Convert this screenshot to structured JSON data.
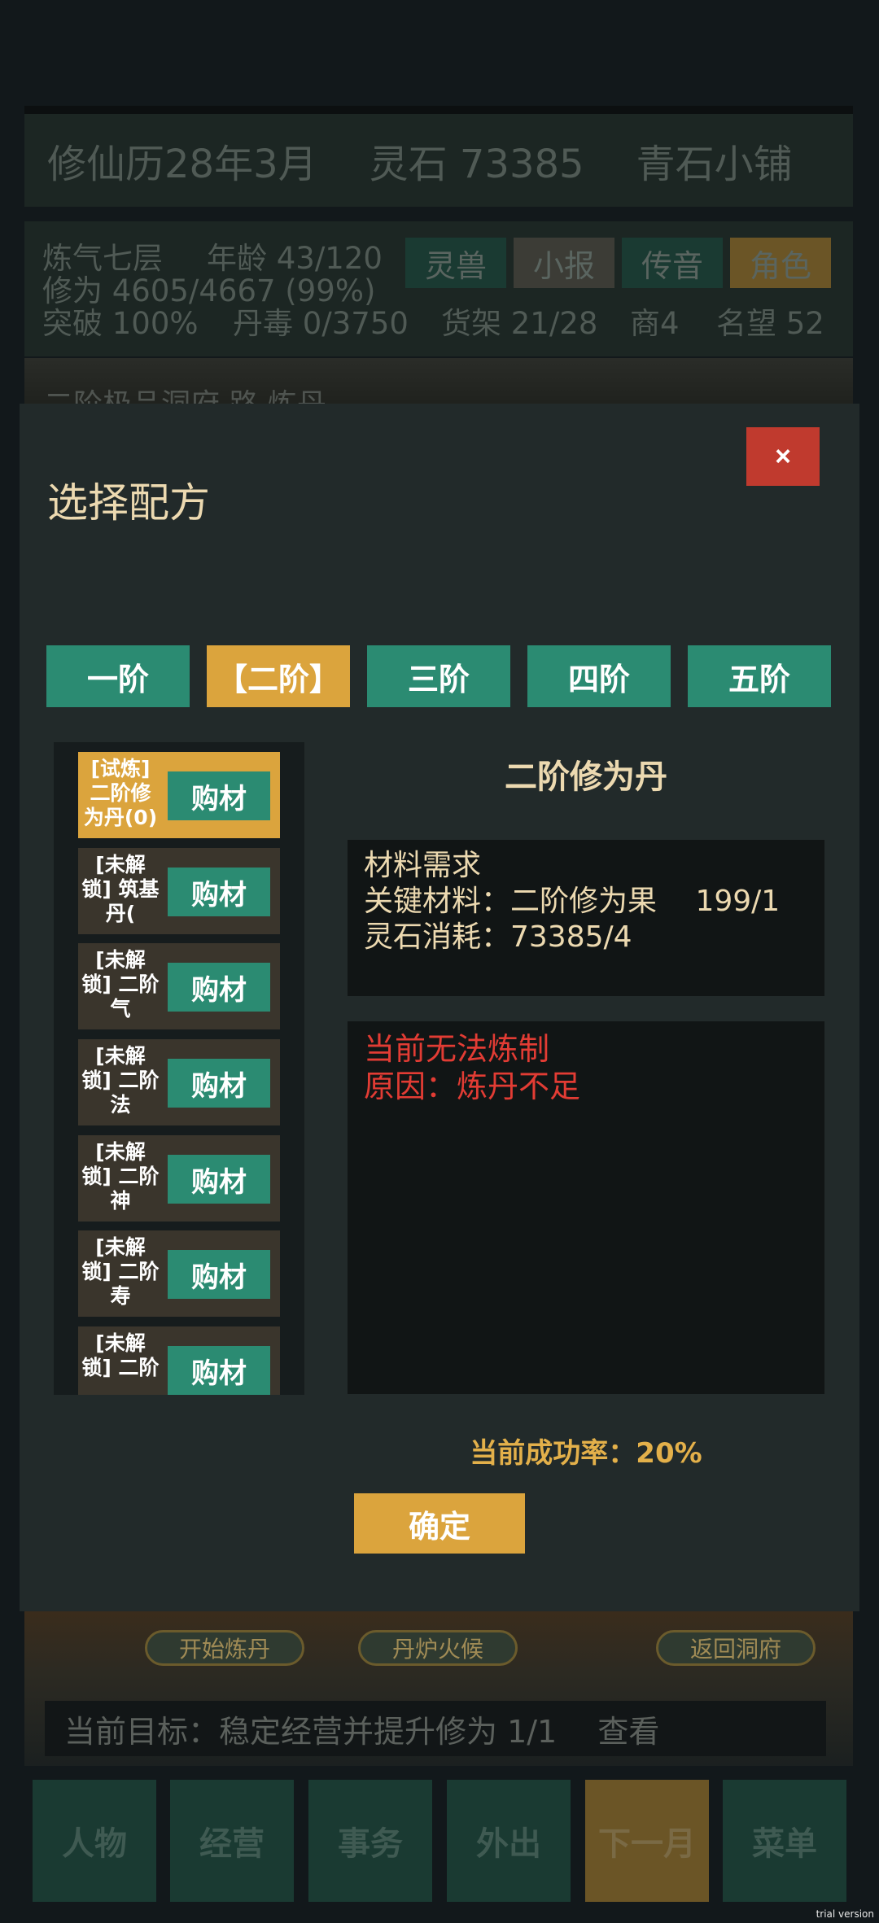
{
  "top_status": {
    "date": "修仙历28年3月",
    "spirit_stone": "灵石 73385",
    "shop_name": "青石小铺"
  },
  "player": {
    "realm": "炼气七层",
    "age": "年龄 43/120",
    "cultivation": "修为 4605/4667 (99%)",
    "breakthrough": "突破 100%",
    "pill_poison": "丹毒 0/3750",
    "shelf": "货架 21/28",
    "merchant": "商4",
    "fame": "名望 52"
  },
  "tags": [
    "灵兽",
    "小报",
    "传音",
    "角色"
  ],
  "tag_colors": [
    "#1a3a32",
    "#3c3c36",
    "#1a3a32",
    "#6b5526"
  ],
  "location": "二阶极品洞府 路 炼丹",
  "modal": {
    "title": "选择配方",
    "close": "×",
    "tiers": [
      "一阶",
      "【二阶】",
      "三阶",
      "四阶",
      "五阶"
    ],
    "selected_tier": 1,
    "recipes": [
      {
        "name": "[试炼] 二阶修为丹(0)",
        "buy": "购材",
        "selected": true
      },
      {
        "name": "[未解锁] 筑基丹(",
        "buy": "购材",
        "selected": false
      },
      {
        "name": "[未解锁] 二阶气",
        "buy": "购材",
        "selected": false
      },
      {
        "name": "[未解锁] 二阶法",
        "buy": "购材",
        "selected": false
      },
      {
        "name": "[未解锁] 二阶神",
        "buy": "购材",
        "selected": false
      },
      {
        "name": "[未解锁] 二阶寿",
        "buy": "购材",
        "selected": false
      },
      {
        "name": "[未解锁] 二阶",
        "buy": "购材",
        "selected": false
      }
    ],
    "detail": {
      "title": "二阶修为丹",
      "req_header": "材料需求",
      "key_material": "关键材料：二阶修为果　 199/1",
      "stone_cost": "灵石消耗：73385/4",
      "fail_status": "当前无法炼制",
      "fail_reason": "原因：炼丹不足"
    },
    "success_rate": "当前成功率：20%",
    "confirm": "确定"
  },
  "scene_buttons": [
    "开始炼丹",
    "丹炉火候",
    "返回洞府"
  ],
  "goal": "当前目标：稳定经营并提升修为 1/1　 查看",
  "bottom_nav": [
    "人物",
    "经营",
    "事务",
    "外出",
    "下一月",
    "菜单"
  ],
  "bottom_nav_active": 4,
  "watermark": "trial version",
  "colors": {
    "accent_gold": "#dba43d",
    "accent_teal": "#2b8b72",
    "danger_red": "#c03a2e",
    "error_text": "#e23c34",
    "cream_text": "#ecd9b0"
  }
}
